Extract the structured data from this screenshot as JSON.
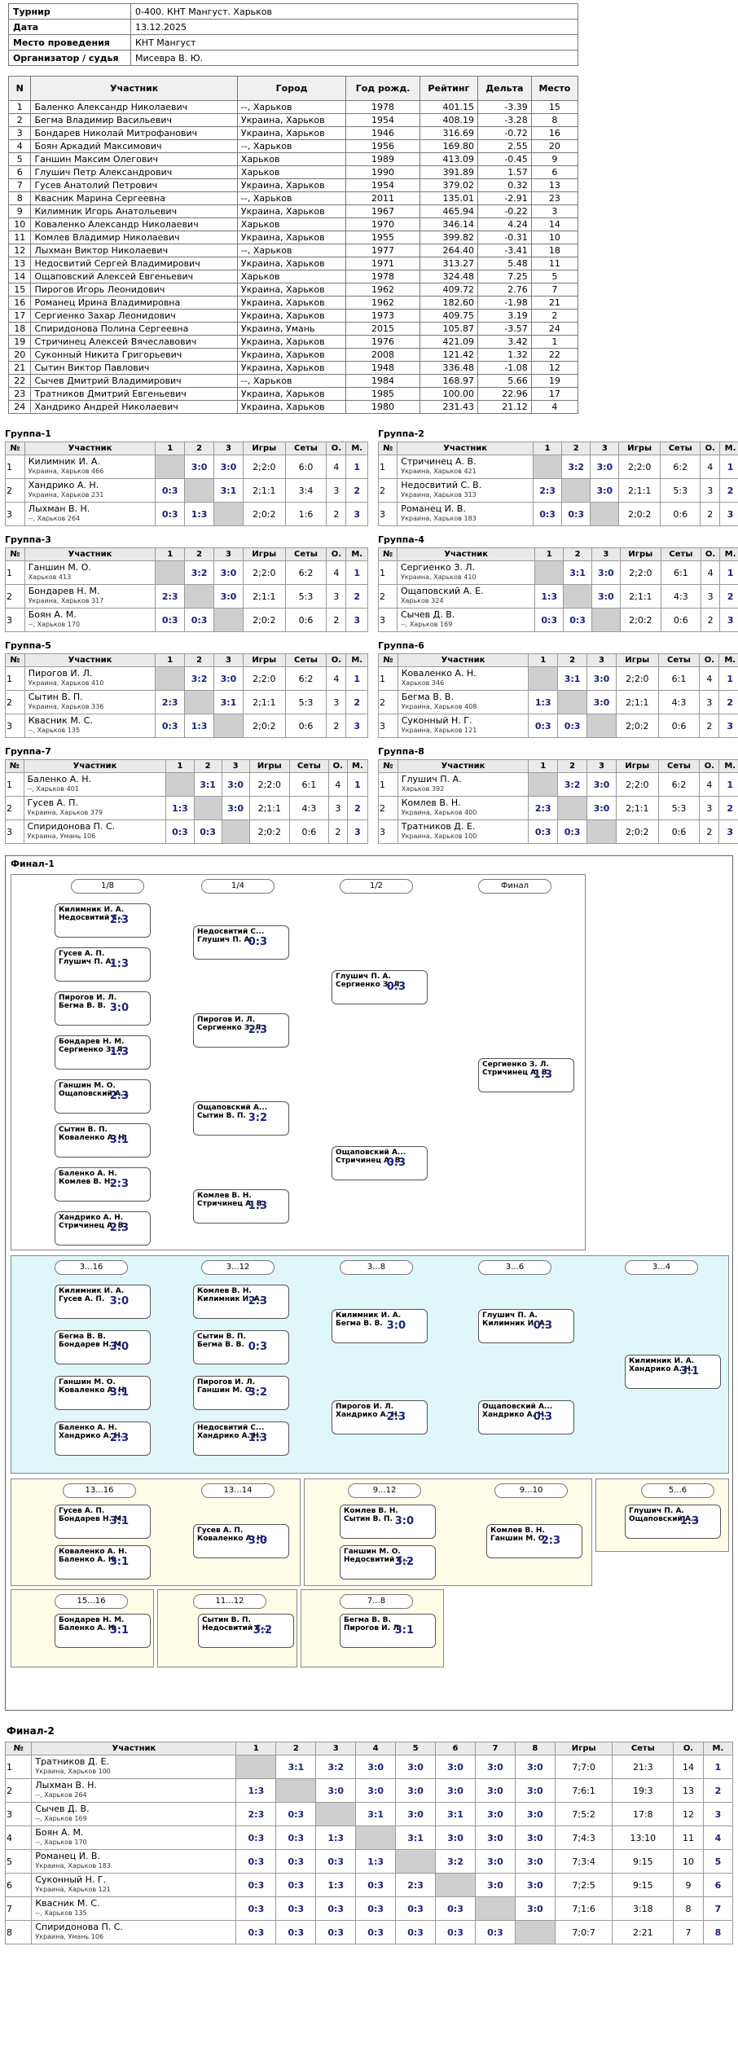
{
  "info": [
    {
      "k": "Турнир",
      "v": "0-400. КНТ Мангуст. Харьков"
    },
    {
      "k": "Дата",
      "v": "13.12.2025"
    },
    {
      "k": "Место проведения",
      "v": "КНТ Мангуст"
    },
    {
      "k": "Организатор / судья",
      "v": "Мисевра В. Ю."
    }
  ],
  "players_headers": [
    "N",
    "Участник",
    "Город",
    "Год рожд.",
    "Рейтинг",
    "Дельта",
    "Место"
  ],
  "players": [
    [
      "1",
      "Баленко Александр Николаевич",
      "--, Харьков",
      "1978",
      "401.15",
      "-3.39",
      "15"
    ],
    [
      "2",
      "Бегма Владимир Васильевич",
      "Украина, Харьков",
      "1954",
      "408.19",
      "-3.28",
      "8"
    ],
    [
      "3",
      "Бондарев Николай Митрофанович",
      "Украина, Харьков",
      "1946",
      "316.69",
      "-0.72",
      "16"
    ],
    [
      "4",
      "Боян Аркадий Максимович",
      "--, Харьков",
      "1956",
      "169.80",
      "2.55",
      "20"
    ],
    [
      "5",
      "Ганшин Максим Олегович",
      "Харьков",
      "1989",
      "413.09",
      "-0.45",
      "9"
    ],
    [
      "6",
      "Глушич Петр Александрович",
      "Харьков",
      "1990",
      "391.89",
      "1.57",
      "6"
    ],
    [
      "7",
      "Гусев Анатолий Петрович",
      "Украина, Харьков",
      "1954",
      "379.02",
      "0.32",
      "13"
    ],
    [
      "8",
      "Квасник Марина Сергеевна",
      "--, Харьков",
      "2011",
      "135.01",
      "-2.91",
      "23"
    ],
    [
      "9",
      "Килимник Игорь Анатольевич",
      "Украина, Харьков",
      "1967",
      "465.94",
      "-0.22",
      "3"
    ],
    [
      "10",
      "Коваленко Александр Николаевич",
      "Харьков",
      "1970",
      "346.14",
      "4.24",
      "14"
    ],
    [
      "11",
      "Комлев Владимир Николаевич",
      "Украина, Харьков",
      "1955",
      "399.82",
      "-0.31",
      "10"
    ],
    [
      "12",
      "Лыхман Виктор Николаевич",
      "--, Харьков",
      "1977",
      "264.40",
      "-3.41",
      "18"
    ],
    [
      "13",
      "Недосвитий Сергей Владимирович",
      "Украина, Харьков",
      "1971",
      "313.27",
      "5.48",
      "11"
    ],
    [
      "14",
      "Ощаповский Алексей Евгеньевич",
      "Харьков",
      "1978",
      "324.48",
      "7.25",
      "5"
    ],
    [
      "15",
      "Пирогов Игорь Леонидович",
      "Украина, Харьков",
      "1962",
      "409.72",
      "2.76",
      "7"
    ],
    [
      "16",
      "Романец Ирина Владимировна",
      "Украина, Харьков",
      "1962",
      "182.60",
      "-1.98",
      "21"
    ],
    [
      "17",
      "Сергиенко Захар Леонидович",
      "Украина, Харьков",
      "1973",
      "409.75",
      "3.19",
      "2"
    ],
    [
      "18",
      "Спиридонова Полина Сергеевна",
      "Украина, Умань",
      "2015",
      "105.87",
      "-3.57",
      "24"
    ],
    [
      "19",
      "Стричинец Алексей Вячеславович",
      "Украина, Харьков",
      "1976",
      "421.09",
      "3.42",
      "1"
    ],
    [
      "20",
      "Суконный Никита Григорьевич",
      "Украина, Харьков",
      "2008",
      "121.42",
      "1.32",
      "22"
    ],
    [
      "21",
      "Сытин Виктор Павлович",
      "Украина, Харьков",
      "1948",
      "336.48",
      "-1.08",
      "12"
    ],
    [
      "22",
      "Сычев Дмитрий Владимирович",
      "--, Харьков",
      "1984",
      "168.97",
      "5.66",
      "19"
    ],
    [
      "23",
      "Тратников Дмитрий Евгеньевич",
      "Украина, Харьков",
      "1985",
      "100.00",
      "22.96",
      "17"
    ],
    [
      "24",
      "Хандрико Андрей Николаевич",
      "Украина, Харьков",
      "1980",
      "231.43",
      "21.12",
      "4"
    ]
  ],
  "group_headers": [
    "№",
    "Участник",
    "1",
    "2",
    "3",
    "Игры",
    "Сеты",
    "О.",
    "М."
  ],
  "groups": [
    {
      "title": "Группа-1",
      "rows": [
        {
          "n": "1",
          "name": "Килимник И. А.",
          "city": "Украина, Харьков",
          "r": "466",
          "c1": "",
          "c2": "3:0",
          "c3": "3:0",
          "games": "2;2:0",
          "sets": "6:0",
          "o": "4",
          "m": "1"
        },
        {
          "n": "2",
          "name": "Хандрико А. Н.",
          "city": "Украина, Харьков",
          "r": "231",
          "c1": "0:3",
          "c2": "",
          "c3": "3:1",
          "games": "2;1:1",
          "sets": "3:4",
          "o": "3",
          "m": "2"
        },
        {
          "n": "3",
          "name": "Лыхман В. Н.",
          "city": "--, Харьков",
          "r": "264",
          "c1": "0:3",
          "c2": "1:3",
          "c3": "",
          "games": "2;0:2",
          "sets": "1:6",
          "o": "2",
          "m": "3"
        }
      ]
    },
    {
      "title": "Группа-2",
      "rows": [
        {
          "n": "1",
          "name": "Стричинец А. В.",
          "city": "Украина, Харьков",
          "r": "421",
          "c1": "",
          "c2": "3:2",
          "c3": "3:0",
          "games": "2;2:0",
          "sets": "6:2",
          "o": "4",
          "m": "1"
        },
        {
          "n": "2",
          "name": "Недосвитий С. В.",
          "city": "Украина, Харьков",
          "r": "313",
          "c1": "2:3",
          "c2": "",
          "c3": "3:0",
          "games": "2;1:1",
          "sets": "5:3",
          "o": "3",
          "m": "2"
        },
        {
          "n": "3",
          "name": "Романец И. В.",
          "city": "Украина, Харьков",
          "r": "183",
          "c1": "0:3",
          "c2": "0:3",
          "c3": "",
          "games": "2;0:2",
          "sets": "0:6",
          "o": "2",
          "m": "3"
        }
      ]
    },
    {
      "title": "Группа-3",
      "rows": [
        {
          "n": "1",
          "name": "Ганшин М. О.",
          "city": "Харьков",
          "r": "413",
          "c1": "",
          "c2": "3:2",
          "c3": "3:0",
          "games": "2;2:0",
          "sets": "6:2",
          "o": "4",
          "m": "1"
        },
        {
          "n": "2",
          "name": "Бондарев Н. М.",
          "city": "Украина, Харьков",
          "r": "317",
          "c1": "2:3",
          "c2": "",
          "c3": "3:0",
          "games": "2;1:1",
          "sets": "5:3",
          "o": "3",
          "m": "2"
        },
        {
          "n": "3",
          "name": "Боян А. М.",
          "city": "--, Харьков",
          "r": "170",
          "c1": "0:3",
          "c2": "0:3",
          "c3": "",
          "games": "2;0:2",
          "sets": "0:6",
          "o": "2",
          "m": "3"
        }
      ]
    },
    {
      "title": "Группа-4",
      "rows": [
        {
          "n": "1",
          "name": "Сергиенко З. Л.",
          "city": "Украина, Харьков",
          "r": "410",
          "c1": "",
          "c2": "3:1",
          "c3": "3:0",
          "games": "2;2:0",
          "sets": "6:1",
          "o": "4",
          "m": "1"
        },
        {
          "n": "2",
          "name": "Ощаповский А. Е.",
          "city": "Харьков",
          "r": "324",
          "c1": "1:3",
          "c2": "",
          "c3": "3:0",
          "games": "2;1:1",
          "sets": "4:3",
          "o": "3",
          "m": "2"
        },
        {
          "n": "3",
          "name": "Сычев Д. В.",
          "city": "--, Харьков",
          "r": "169",
          "c1": "0:3",
          "c2": "0:3",
          "c3": "",
          "games": "2;0:2",
          "sets": "0:6",
          "o": "2",
          "m": "3"
        }
      ]
    },
    {
      "title": "Группа-5",
      "rows": [
        {
          "n": "1",
          "name": "Пирогов И. Л.",
          "city": "Украина, Харьков",
          "r": "410",
          "c1": "",
          "c2": "3:2",
          "c3": "3:0",
          "games": "2;2:0",
          "sets": "6:2",
          "o": "4",
          "m": "1"
        },
        {
          "n": "2",
          "name": "Сытин В. П.",
          "city": "Украина, Харьков",
          "r": "336",
          "c1": "2:3",
          "c2": "",
          "c3": "3:1",
          "games": "2;1:1",
          "sets": "5:3",
          "o": "3",
          "m": "2"
        },
        {
          "n": "3",
          "name": "Квасник М. С.",
          "city": "--, Харьков",
          "r": "135",
          "c1": "0:3",
          "c2": "1:3",
          "c3": "",
          "games": "2;0:2",
          "sets": "0:6",
          "o": "2",
          "m": "3"
        }
      ]
    },
    {
      "title": "Группа-6",
      "rows": [
        {
          "n": "1",
          "name": "Коваленко А. Н.",
          "city": "Харьков",
          "r": "346",
          "c1": "",
          "c2": "3:1",
          "c3": "3:0",
          "games": "2;2:0",
          "sets": "6:1",
          "o": "4",
          "m": "1"
        },
        {
          "n": "2",
          "name": "Бегма В. В.",
          "city": "Украина, Харьков",
          "r": "408",
          "c1": "1:3",
          "c2": "",
          "c3": "3:0",
          "games": "2;1:1",
          "sets": "4:3",
          "o": "3",
          "m": "2"
        },
        {
          "n": "3",
          "name": "Суконный Н. Г.",
          "city": "Украина, Харьков",
          "r": "121",
          "c1": "0:3",
          "c2": "0:3",
          "c3": "",
          "games": "2;0:2",
          "sets": "0:6",
          "o": "2",
          "m": "3"
        }
      ]
    },
    {
      "title": "Группа-7",
      "rows": [
        {
          "n": "1",
          "name": "Баленко А. Н.",
          "city": "--, Харьков",
          "r": "401",
          "c1": "",
          "c2": "3:1",
          "c3": "3:0",
          "games": "2;2:0",
          "sets": "6:1",
          "o": "4",
          "m": "1"
        },
        {
          "n": "2",
          "name": "Гусев А. П.",
          "city": "Украина, Харьков",
          "r": "379",
          "c1": "1:3",
          "c2": "",
          "c3": "3:0",
          "games": "2;1:1",
          "sets": "4:3",
          "o": "3",
          "m": "2"
        },
        {
          "n": "3",
          "name": "Спиридонова П. С.",
          "city": "Украина, Умань",
          "r": "106",
          "c1": "0:3",
          "c2": "0:3",
          "c3": "",
          "games": "2;0:2",
          "sets": "0:6",
          "o": "2",
          "m": "3"
        }
      ]
    },
    {
      "title": "Группа-8",
      "rows": [
        {
          "n": "1",
          "name": "Глушич П. А.",
          "city": "Харьков",
          "r": "392",
          "c1": "",
          "c2": "3:2",
          "c3": "3:0",
          "games": "2;2:0",
          "sets": "6:2",
          "o": "4",
          "m": "1"
        },
        {
          "n": "2",
          "name": "Комлев В. Н.",
          "city": "Украина, Харьков",
          "r": "400",
          "c1": "2:3",
          "c2": "",
          "c3": "3:0",
          "games": "2;1:1",
          "sets": "5:3",
          "o": "3",
          "m": "2"
        },
        {
          "n": "3",
          "name": "Тратников Д. Е.",
          "city": "Украина, Харьков",
          "r": "100",
          "c1": "0:3",
          "c2": "0:3",
          "c3": "",
          "games": "2;0:2",
          "sets": "0:6",
          "o": "2",
          "m": "3"
        }
      ]
    }
  ],
  "final1": {
    "title": "Финал-1",
    "stages": [
      "1/8",
      "1/4",
      "1/2",
      "Финал",
      "3...16",
      "3...12",
      "3...8",
      "3...6",
      "3...4",
      "13...16",
      "13...14",
      "9...12",
      "9...10",
      "5...6",
      "15...16",
      "11...12",
      "7...8"
    ],
    "matches": [
      {
        "a": "Килимник И. А.",
        "b": "Недосвитий С...",
        "s": "2:3"
      },
      {
        "a": "Гусев А. П.",
        "b": "Глушич П. А.",
        "s": "1:3"
      },
      {
        "a": "Пирогов И. Л.",
        "b": "Бегма В. В.",
        "s": "3:0"
      },
      {
        "a": "Бондарев Н. М.",
        "b": "Сергиенко З. Л.",
        "s": "1:3"
      },
      {
        "a": "Ганшин М. О.",
        "b": "Ощаповский А...",
        "s": "2:3"
      },
      {
        "a": "Сытин В. П.",
        "b": "Коваленко А. Н.",
        "s": "3:1"
      },
      {
        "a": "Баленко А. Н.",
        "b": "Комлев В. Н.",
        "s": "2:3"
      },
      {
        "a": "Хандрико А. Н.",
        "b": "Стричинец А. В.",
        "s": "2:3"
      },
      {
        "a": "Недосвитий С...",
        "b": "Глушич П. А.",
        "s": "0:3"
      },
      {
        "a": "Пирогов И. Л.",
        "b": "Сергиенко З. Л.",
        "s": "2:3"
      },
      {
        "a": "Ощаповский А...",
        "b": "Сытин В. П.",
        "s": "3:2"
      },
      {
        "a": "Комлев В. Н.",
        "b": "Стричинец А. В.",
        "s": "1:3"
      },
      {
        "a": "Глушич П. А.",
        "b": "Сергиенко З. Л.",
        "s": "0:3"
      },
      {
        "a": "Ощаповский А...",
        "b": "Стричинец А. В.",
        "s": "0:3"
      },
      {
        "a": "Сергиенко З. Л.",
        "b": "Стричинец А. В.",
        "s": "1:3"
      },
      {
        "a": "Килимник И. А.",
        "b": "Гусев А. П.",
        "s": "3:0"
      },
      {
        "a": "Бегма В. В.",
        "b": "Бондарев Н. М.",
        "s": "3:0"
      },
      {
        "a": "Ганшин М. О.",
        "b": "Коваленко А. Н.",
        "s": "3:1"
      },
      {
        "a": "Баленко А. Н.",
        "b": "Хандрико А. Н.",
        "s": "2:3"
      },
      {
        "a": "Комлев В. Н.",
        "b": "Килимник И. А.",
        "s": "2:3"
      },
      {
        "a": "Сытин В. П.",
        "b": "Бегма В. В.",
        "s": "0:3"
      },
      {
        "a": "Пирогов И. Л.",
        "b": "Ганшин М. О.",
        "s": "3:2"
      },
      {
        "a": "Недосвитий С...",
        "b": "Хандрико А. Н.",
        "s": "1:3"
      },
      {
        "a": "Килимник И. А.",
        "b": "Бегма В. В.",
        "s": "3:0"
      },
      {
        "a": "Пирогов И. Л.",
        "b": "Хандрико А. Н.",
        "s": "2:3"
      },
      {
        "a": "Глушич П. А.",
        "b": "Килимник И. А.",
        "s": "0:3"
      },
      {
        "a": "Ощаповский А...",
        "b": "Хандрико А. Н.",
        "s": "0:3"
      },
      {
        "a": "Килимник И. А.",
        "b": "Хандрико А. Н.",
        "s": "3:1"
      },
      {
        "a": "Гусев А. П.",
        "b": "Бондарев Н. М.",
        "s": "3:1"
      },
      {
        "a": "Коваленко А. Н.",
        "b": "Баленко А. Н.",
        "s": "3:1"
      },
      {
        "a": "Гусев А. П.",
        "b": "Коваленко А. Н.",
        "s": "3:0"
      },
      {
        "a": "Комлев В. Н.",
        "b": "Сытин В. П.",
        "s": "3:0"
      },
      {
        "a": "Ганшин М. О.",
        "b": "Недосвитий С...",
        "s": "3:2"
      },
      {
        "a": "Комлев В. Н.",
        "b": "Ганшин М. О.",
        "s": "2:3"
      },
      {
        "a": "Глушич П. А.",
        "b": "Ощаповский А...",
        "s": "1:3"
      },
      {
        "a": "Бондарев Н. М.",
        "b": "Баленко А. Н.",
        "s": "3:1"
      },
      {
        "a": "Сытин В. П.",
        "b": "Недосвитий С...",
        "s": "3:2"
      },
      {
        "a": "Бегма В. В.",
        "b": "Пирогов И. Л.",
        "s": "3:1"
      }
    ]
  },
  "final2": {
    "title": "Финал-2",
    "headers": [
      "№",
      "Участник",
      "1",
      "2",
      "3",
      "4",
      "5",
      "6",
      "7",
      "8",
      "Игры",
      "Сеты",
      "О.",
      "М."
    ],
    "rows": [
      {
        "n": "1",
        "name": "Тратников Д. Е.",
        "city": "Украина, Харьков",
        "r": "100",
        "cells": [
          "",
          "3:1",
          "3:2",
          "3:0",
          "3:0",
          "3:0",
          "3:0",
          "3:0"
        ],
        "games": "7;7:0",
        "sets": "21:3",
        "o": "14",
        "m": "1"
      },
      {
        "n": "2",
        "name": "Лыхман В. Н.",
        "city": "--, Харьков",
        "r": "264",
        "cells": [
          "1:3",
          "",
          "3:0",
          "3:0",
          "3:0",
          "3:0",
          "3:0",
          "3:0"
        ],
        "games": "7;6:1",
        "sets": "19:3",
        "o": "13",
        "m": "2"
      },
      {
        "n": "3",
        "name": "Сычев Д. В.",
        "city": "--, Харьков",
        "r": "169",
        "cells": [
          "2:3",
          "0:3",
          "",
          "3:1",
          "3:0",
          "3:1",
          "3:0",
          "3:0"
        ],
        "games": "7;5:2",
        "sets": "17:8",
        "o": "12",
        "m": "3"
      },
      {
        "n": "4",
        "name": "Боян А. М.",
        "city": "--, Харьков",
        "r": "170",
        "cells": [
          "0:3",
          "0:3",
          "1:3",
          "",
          "3:1",
          "3:0",
          "3:0",
          "3:0"
        ],
        "games": "7;4:3",
        "sets": "13:10",
        "o": "11",
        "m": "4"
      },
      {
        "n": "5",
        "name": "Романец И. В.",
        "city": "Украина, Харьков",
        "r": "183",
        "cells": [
          "0:3",
          "0:3",
          "0:3",
          "1:3",
          "",
          "3:2",
          "3:0",
          "3:0"
        ],
        "games": "7;3:4",
        "sets": "9:15",
        "o": "10",
        "m": "5"
      },
      {
        "n": "6",
        "name": "Суконный Н. Г.",
        "city": "Украина, Харьков",
        "r": "121",
        "cells": [
          "0:3",
          "0:3",
          "1:3",
          "0:3",
          "2:3",
          "",
          "3:0",
          "3:0"
        ],
        "games": "7;2:5",
        "sets": "9:15",
        "o": "9",
        "m": "6"
      },
      {
        "n": "7",
        "name": "Квасник М. С.",
        "city": "--, Харьков",
        "r": "135",
        "cells": [
          "0:3",
          "0:3",
          "0:3",
          "0:3",
          "0:3",
          "0:3",
          "",
          "3:0"
        ],
        "games": "7;1:6",
        "sets": "3:18",
        "o": "8",
        "m": "7"
      },
      {
        "n": "8",
        "name": "Спиридонова П. С.",
        "city": "Украина, Умань",
        "r": "106",
        "cells": [
          "0:3",
          "0:3",
          "0:3",
          "0:3",
          "0:3",
          "0:3",
          "0:3",
          ""
        ],
        "games": "7;0:7",
        "sets": "2:21",
        "o": "7",
        "m": "8"
      }
    ]
  }
}
